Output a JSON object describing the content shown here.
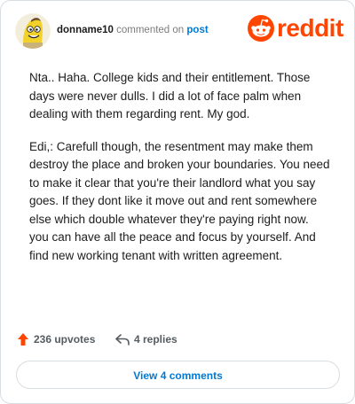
{
  "comment": {
    "username": "donname10",
    "action_text": "commented on",
    "post_link": "post",
    "paragraphs": [
      "Nta.. Haha. College kids and their entitlement. Those days were never dulls. I did a lot of face palm when dealing with them regarding rent. My god.",
      "Edi,: Carefull though, the resentment may make them destroy the place and broken your boundaries. You need to make it clear that you're their landlord what you say goes. If they dont like it move out and rent somewhere else which double whatever they're paying right now. you can have all the peace and focus by yourself. And find new working tenant with written agreement."
    ]
  },
  "brand": {
    "logo_text": "reddit",
    "icon": "reddit-snoo-icon",
    "color": "#ff4500"
  },
  "footer": {
    "upvotes_label": "236 upvotes",
    "replies_label": "4 replies",
    "upvote_icon": "upvote-arrow-icon",
    "reply_icon": "reply-arrow-icon"
  },
  "view_comments_button": {
    "label": "View 4 comments"
  },
  "colors": {
    "accent": "#ff4500",
    "link": "#0079d3",
    "text": "#1c1c1c",
    "muted": "#7c7c7c",
    "border": "#d8dde1"
  }
}
